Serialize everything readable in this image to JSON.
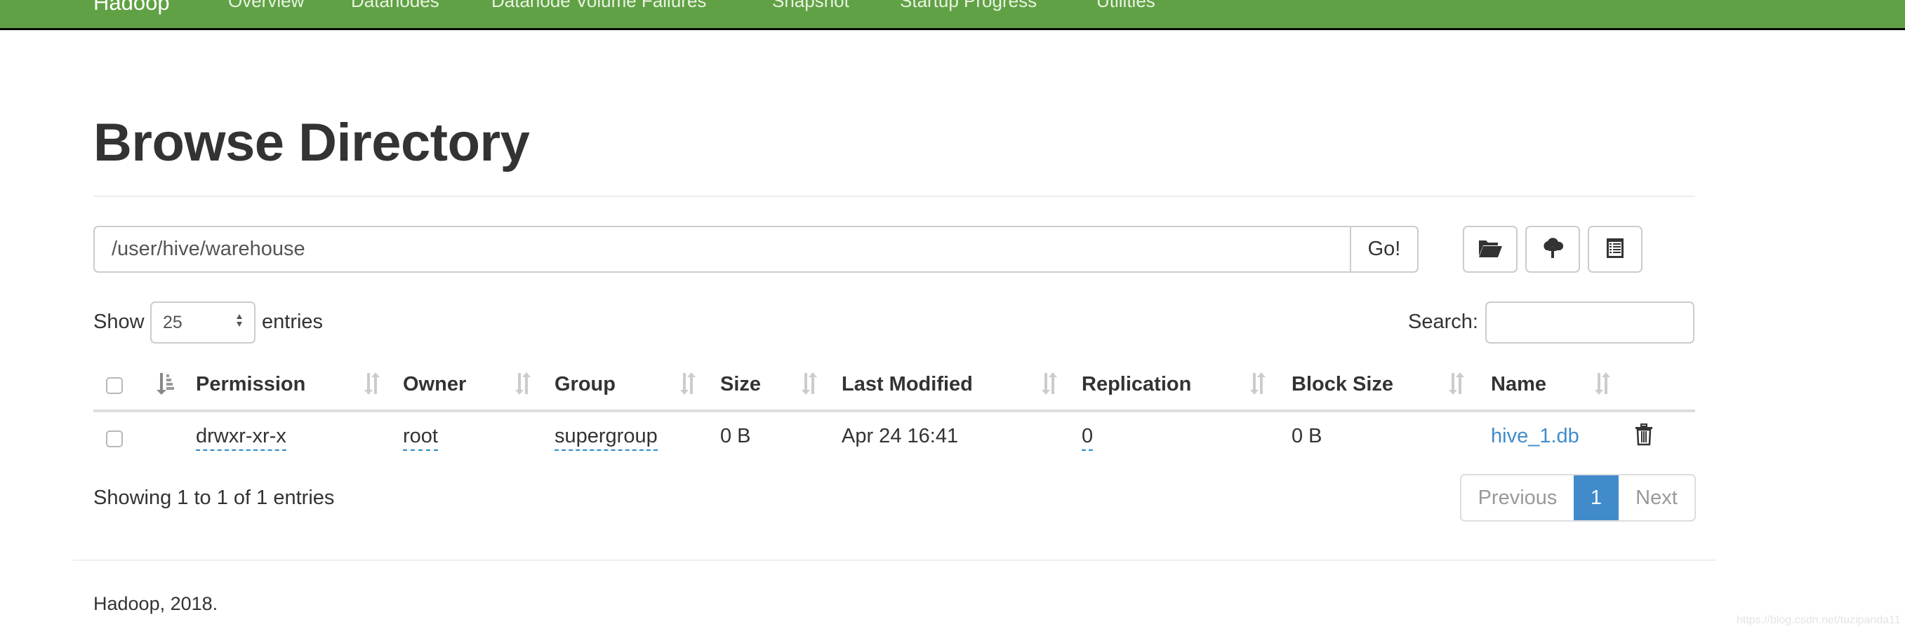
{
  "navbar": {
    "brand": "Hadoop",
    "items": [
      "Overview",
      "Datanodes",
      "Datanode Volume Failures",
      "Snapshot",
      "Startup Progress",
      "Utilities"
    ],
    "color": "#61a146"
  },
  "page": {
    "title": "Browse Directory"
  },
  "path_bar": {
    "value": "/user/hive/warehouse",
    "go_label": "Go!"
  },
  "toolbar": {
    "buttons": [
      {
        "icon": "folder-open-icon",
        "action": "create-directory"
      },
      {
        "icon": "cloud-upload-icon",
        "action": "upload"
      },
      {
        "icon": "list-alt-icon",
        "action": "cut-paste"
      }
    ]
  },
  "table_controls": {
    "show_label": "Show",
    "page_length": "25",
    "entries_label": "entries",
    "search_label": "Search:",
    "search_value": ""
  },
  "table": {
    "columns": [
      "Permission",
      "Owner",
      "Group",
      "Size",
      "Last Modified",
      "Replication",
      "Block Size",
      "Name"
    ],
    "rows": [
      {
        "permission": "drwxr-xr-x",
        "owner": "root",
        "group": "supergroup",
        "size": "0 B",
        "last_modified": "Apr 24 16:41",
        "replication": "0",
        "block_size": "0 B",
        "name": "hive_1.db"
      }
    ]
  },
  "pagination": {
    "info": "Showing 1 to 1 of 1 entries",
    "previous_label": "Previous",
    "current_page": "1",
    "next_label": "Next",
    "accent": "#428bca"
  },
  "footer": {
    "text": "Hadoop, 2018."
  },
  "watermark": "https://blog.csdn.net/tuzipanda11"
}
